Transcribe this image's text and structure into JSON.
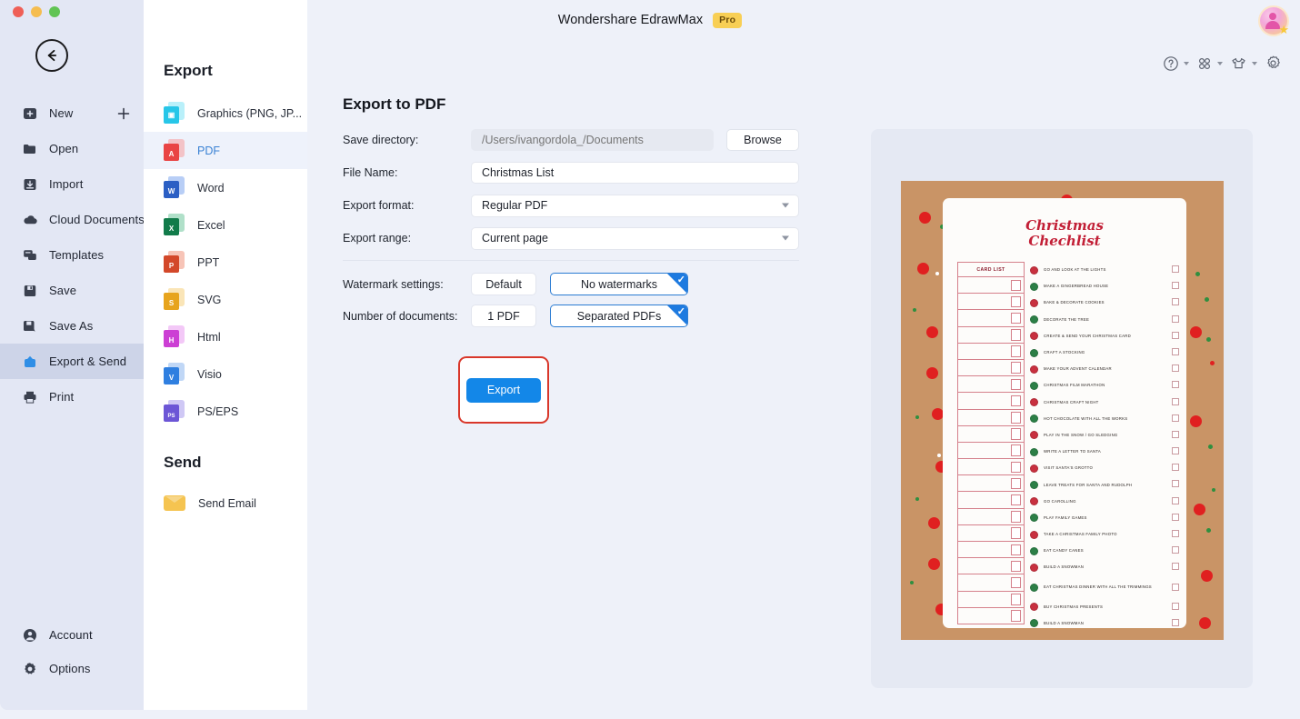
{
  "window": {
    "traffic_lights": [
      "close",
      "minimize",
      "maximize"
    ],
    "back_button": "back-arrow"
  },
  "header": {
    "app_title": "Wondershare EdrawMax",
    "pro_badge": "Pro",
    "toolbar_icons": [
      "help-icon",
      "apps-grid-icon",
      "theme-shirt-icon",
      "gear-icon"
    ],
    "avatar": "user-avatar"
  },
  "sidebar": {
    "items": [
      {
        "label": "New",
        "icon": "new-document-icon",
        "active": false,
        "has_plus": true
      },
      {
        "label": "Open",
        "icon": "folder-icon",
        "active": false,
        "has_plus": false
      },
      {
        "label": "Import",
        "icon": "import-icon",
        "active": false,
        "has_plus": false
      },
      {
        "label": "Cloud Documents",
        "icon": "cloud-icon",
        "active": false,
        "has_plus": false
      },
      {
        "label": "Templates",
        "icon": "templates-icon",
        "active": false,
        "has_plus": false
      },
      {
        "label": "Save",
        "icon": "save-icon",
        "active": false,
        "has_plus": false
      },
      {
        "label": "Save As",
        "icon": "save-as-icon",
        "active": false,
        "has_plus": false
      },
      {
        "label": "Export & Send",
        "icon": "export-send-icon",
        "active": true,
        "has_plus": false
      },
      {
        "label": "Print",
        "icon": "printer-icon",
        "active": false,
        "has_plus": false
      }
    ],
    "bottom_items": [
      {
        "label": "Account",
        "icon": "account-icon"
      },
      {
        "label": "Options",
        "icon": "options-gear-icon"
      }
    ]
  },
  "export_list": {
    "title": "Export",
    "formats": [
      {
        "label": "Graphics (PNG, JP...",
        "glyph": "",
        "front": "#27c6e8",
        "back": "#7fe3f5",
        "active": false
      },
      {
        "label": "PDF",
        "glyph": "A",
        "front": "#e94444",
        "back": "#f79d9d",
        "active": true
      },
      {
        "label": "Word",
        "glyph": "W",
        "front": "#2b5fc4",
        "back": "#7ea5ef",
        "active": false
      },
      {
        "label": "Excel",
        "glyph": "X",
        "front": "#117b4a",
        "back": "#6fc79c",
        "active": false
      },
      {
        "label": "PPT",
        "glyph": "P",
        "front": "#d3482a",
        "back": "#f0937c",
        "active": false
      },
      {
        "label": "SVG",
        "glyph": "S",
        "front": "#e7a41d",
        "back": "#f5cf7c",
        "active": false
      },
      {
        "label": "Html",
        "glyph": "H",
        "front": "#cc3fd4",
        "back": "#e99bf0",
        "active": false
      },
      {
        "label": "Visio",
        "glyph": "V",
        "front": "#2f7fe0",
        "back": "#8db7ef",
        "active": false
      },
      {
        "label": "PS/EPS",
        "glyph": "PS",
        "front": "#6c56d6",
        "back": "#a89bec",
        "active": false
      }
    ],
    "send_title": "Send",
    "send_items": [
      {
        "label": "Send Email",
        "icon": "email-icon"
      }
    ]
  },
  "form": {
    "title": "Export to PDF",
    "save_directory": {
      "label": "Save directory:",
      "value": "/Users/ivangordola_/Documents",
      "placeholder": "/Users/ivangordola_/Documents",
      "browse_label": "Browse"
    },
    "file_name": {
      "label": "File Name:",
      "value": "Christmas List"
    },
    "export_format": {
      "label": "Export format:",
      "value": "Regular PDF"
    },
    "export_range": {
      "label": "Export range:",
      "value": "Current page"
    },
    "watermark": {
      "label": "Watermark settings:",
      "option_default": "Default",
      "option_none": "No watermarks",
      "selected": "No watermarks"
    },
    "documents": {
      "label": "Number of documents:",
      "option_single": "1 PDF",
      "option_separated": "Separated PDFs",
      "selected": "Separated PDFs"
    },
    "export_button": "Export",
    "annotation_color": "#d9372a",
    "accent_color": "#1387e8"
  },
  "preview": {
    "doc_title_line1": "Christmas",
    "doc_title_line2": "Chechlist",
    "card_list_header": "CARD LIST",
    "card_list_rows": 21,
    "checklist": [
      {
        "text": "GO AND LOOK AT THE LIGHTS",
        "color": "#c8303f"
      },
      {
        "text": "MAKE A GINGERBREAD HOUSE",
        "color": "#2c7f46"
      },
      {
        "text": "BAKE & DECORATE COOKIES",
        "color": "#c8303f"
      },
      {
        "text": "DECORATE THE TREE",
        "color": "#2c7f46"
      },
      {
        "text": "CREATE & SEND YOUR CHRISTMAS CARD",
        "color": "#c8303f"
      },
      {
        "text": "CRAFT A STOCKING",
        "color": "#2c7f46"
      },
      {
        "text": "MAKE YOUR ADVENT CALENDAR",
        "color": "#c8303f"
      },
      {
        "text": "CHRISTMAS FILM MARATHON",
        "color": "#2c7f46"
      },
      {
        "text": "CHRISTMAS CRAFT NIGHT",
        "color": "#c8303f"
      },
      {
        "text": "HOT CHOCOLATE WITH ALL THE WORKS",
        "color": "#2c7f46"
      },
      {
        "text": "PLAY IN THE SNOW / GO SLEDGING",
        "color": "#c8303f"
      },
      {
        "text": "WRITE A LETTER TO SANTA",
        "color": "#2c7f46"
      },
      {
        "text": "VISIT SANTA'S GROTTO",
        "color": "#c8303f"
      },
      {
        "text": "LEAVE TREATS FOR SANTA AND RUDOLPH",
        "color": "#2c7f46"
      },
      {
        "text": "GO CAROLLING",
        "color": "#c8303f"
      },
      {
        "text": "PLAY FAMILY GAMES",
        "color": "#2c7f46"
      },
      {
        "text": "TAKE A CHRISTMAS FAMILY PHOTO",
        "color": "#c8303f"
      },
      {
        "text": "EAT CANDY CANES",
        "color": "#2c7f46"
      },
      {
        "text": "BUILD A SNOWMAN",
        "color": "#c8303f"
      },
      {
        "text": "EAT CHRISTMAS DINNER WITH ALL THE TRIMMINGS",
        "color": "#2c7f46"
      },
      {
        "text": "BUY CHRISTMAS PRESENTS",
        "color": "#c8303f"
      },
      {
        "text": "BUILD A SNOWMAN",
        "color": "#2c7f46"
      }
    ],
    "background_color": "#c99466",
    "title_color": "#c21f36"
  }
}
